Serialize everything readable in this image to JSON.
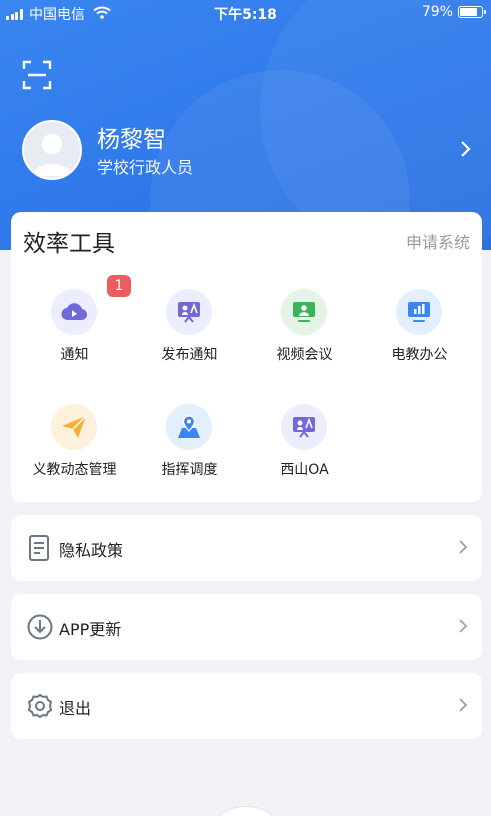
{
  "status_bar": {
    "carrier": "中国电信",
    "time": "下午5:18",
    "battery": "79%",
    "battery_level": 0.79
  },
  "profile": {
    "name": "杨黎智",
    "role": "学校行政人员"
  },
  "tools": {
    "title": "效率工具",
    "link": "申请系统",
    "items": [
      {
        "label": "通知",
        "icon": "cloud-play-icon",
        "badge": "1",
        "color": "#6f6ad8",
        "bg": "#eceefe"
      },
      {
        "label": "发布通知",
        "icon": "presentation-icon",
        "color": "#6f6ad8",
        "bg": "#eceefe"
      },
      {
        "label": "视频会议",
        "icon": "video-meeting-icon",
        "color": "#3fb25c",
        "bg": "#e2f5e7"
      },
      {
        "label": "电教办公",
        "icon": "bar-chart-screen-icon",
        "color": "#3b86f0",
        "bg": "#e3effd"
      },
      {
        "label": "义教动态管理",
        "icon": "paper-plane-icon",
        "color": "#f2b23a",
        "bg": "#fdf1dc"
      },
      {
        "label": "指挥调度",
        "icon": "map-pin-icon",
        "color": "#3b86f0",
        "bg": "#e3effd"
      },
      {
        "label": "西山OA",
        "icon": "presentation-icon",
        "color": "#6f6ad8",
        "bg": "#eceefe"
      }
    ]
  },
  "menu": [
    {
      "label": "隐私政策",
      "icon": "document-icon"
    },
    {
      "label": "APP更新",
      "icon": "download-circle-icon"
    },
    {
      "label": "退出",
      "icon": "gear-icon"
    }
  ]
}
